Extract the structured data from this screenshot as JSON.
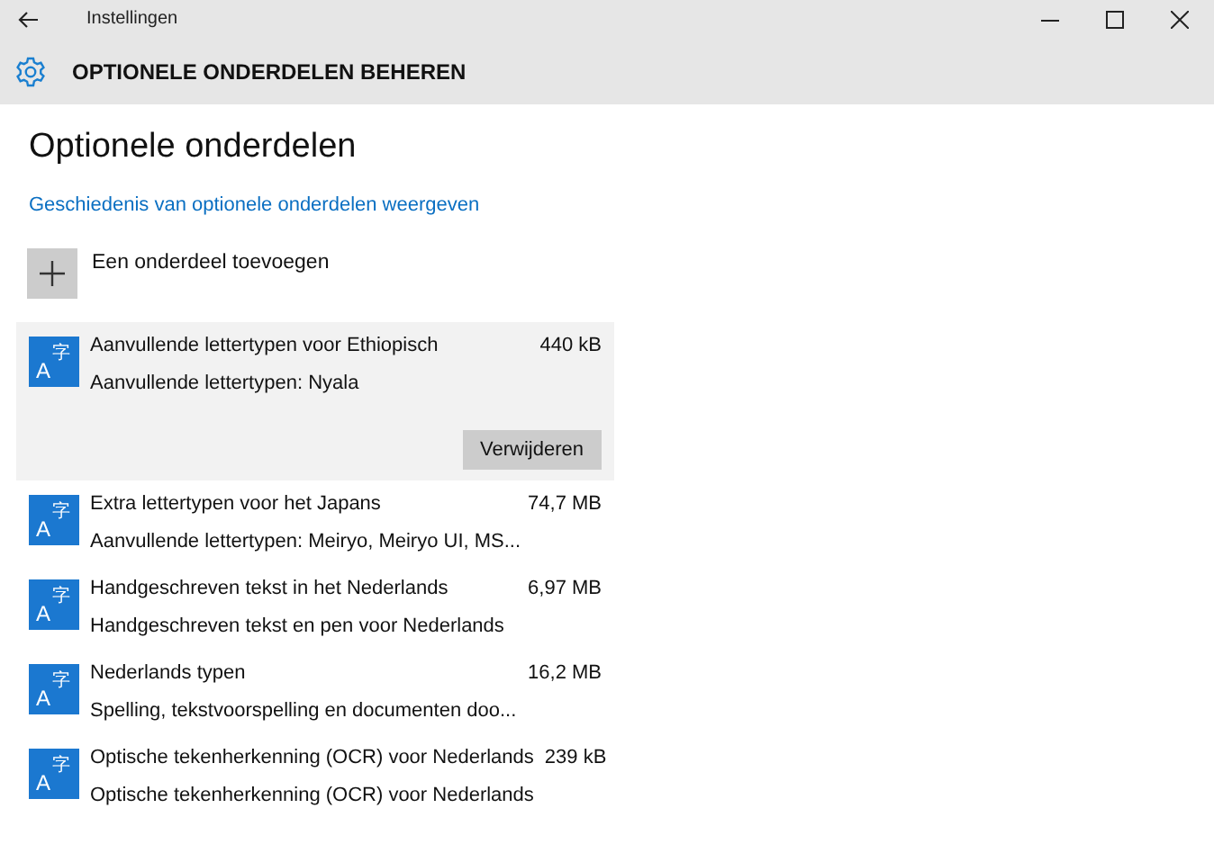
{
  "window": {
    "title": "Instellingen"
  },
  "header": {
    "title": "OPTIONELE ONDERDELEN BEHEREN"
  },
  "page": {
    "title": "Optionele onderdelen",
    "history_link": "Geschiedenis van optionele onderdelen weergeven",
    "add_label": "Een onderdeel toevoegen"
  },
  "features": [
    {
      "icon_letter": "A",
      "icon_glyph": "字",
      "name": "Aanvullende lettertypen voor Ethiopisch",
      "size": "440 kB",
      "description": "Aanvullende lettertypen: Nyala",
      "selected": true,
      "action": "Verwijderen"
    },
    {
      "icon_letter": "A",
      "icon_glyph": "字",
      "name": "Extra lettertypen voor het Japans",
      "size": "74,7 MB",
      "description": "Aanvullende lettertypen: Meiryo, Meiryo UI, MS...",
      "selected": false
    },
    {
      "icon_letter": "A",
      "icon_glyph": "字",
      "name": "Handgeschreven tekst in het Nederlands",
      "size": "6,97 MB",
      "description": "Handgeschreven tekst en pen voor Nederlands",
      "selected": false
    },
    {
      "icon_letter": "A",
      "icon_glyph": "字",
      "name": "Nederlands typen",
      "size": "16,2 MB",
      "description": "Spelling, tekstvoorspelling en documenten doo...",
      "selected": false
    },
    {
      "icon_letter": "A",
      "icon_glyph": "字",
      "name": "Optische tekenherkenning (OCR) voor Nederlands",
      "size": "239 kB",
      "description": "Optische tekenherkenning (OCR) voor Nederlands",
      "selected": false
    }
  ]
}
